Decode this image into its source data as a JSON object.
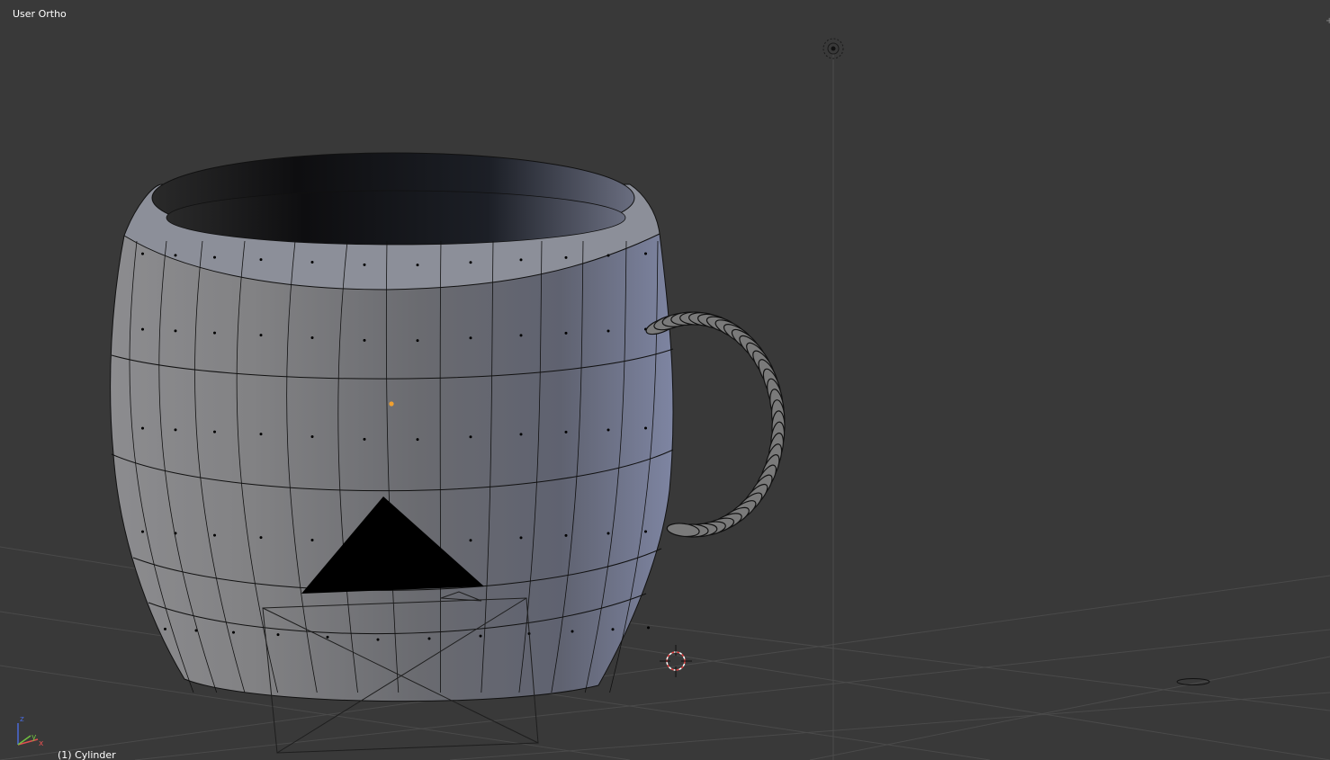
{
  "viewport": {
    "view_label": "User Ortho",
    "object_info": "(1) Cylinder",
    "background_color": "#393939",
    "grid_line_color": "#4a4a4a",
    "axis_gizmo": {
      "x_label": "x",
      "y_label": "y",
      "z_label": "z",
      "x_color": "#e05050",
      "y_color": "#70c040",
      "z_color": "#4a6ad8"
    },
    "icons": [
      "lamp-icon",
      "3d-cursor-icon",
      "camera-icon",
      "object-origin-icon",
      "axis-gizmo-icon",
      "empty-circle-icon"
    ]
  },
  "mesh": {
    "name": "Cylinder",
    "mode": "edit",
    "body_color": "#8a8d94",
    "wire_color": "#111111",
    "vertex_color": "#000000",
    "origin_color": "#f0a030"
  }
}
